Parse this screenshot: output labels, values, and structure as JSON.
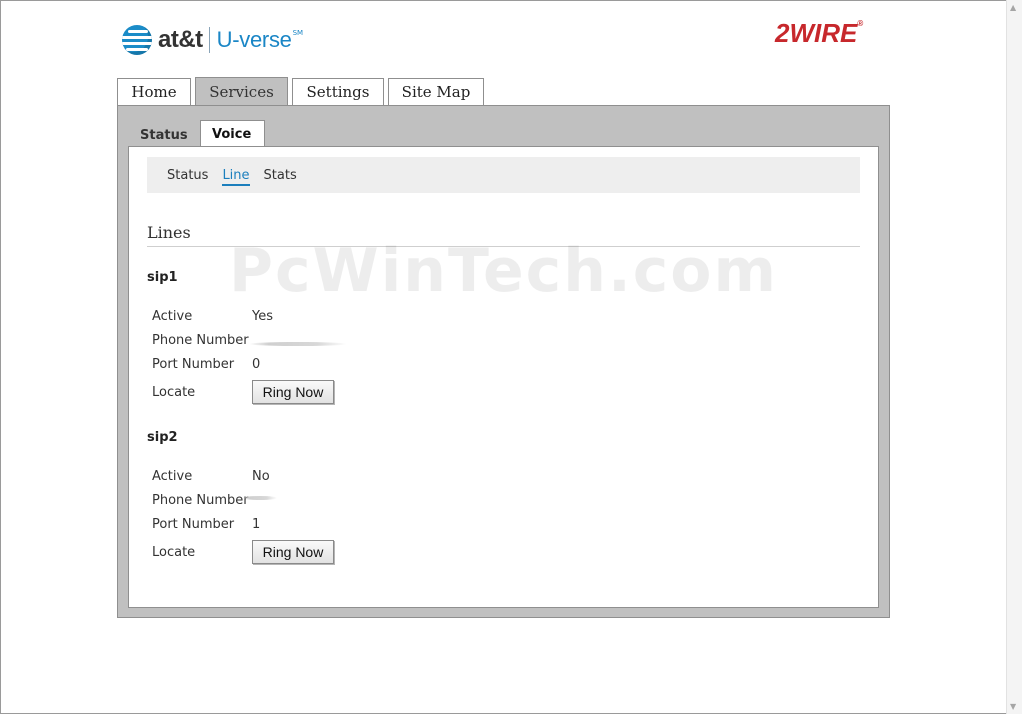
{
  "brand": {
    "att_text": "at&t",
    "uverse_text": "U-verse",
    "uverse_tm": "SM",
    "twowire_text": "2WIRE",
    "twowire_reg": "®",
    "att_color": "#1b8cc8",
    "twowire_color": "#c7282c"
  },
  "main_tabs": [
    {
      "label": "Home",
      "active": false
    },
    {
      "label": "Services",
      "active": true
    },
    {
      "label": "Settings",
      "active": false
    },
    {
      "label": "Site Map",
      "active": false
    }
  ],
  "sub_tabs": [
    {
      "label": "Status",
      "active": false
    },
    {
      "label": "Voice",
      "active": true
    }
  ],
  "subnav": [
    {
      "label": "Status",
      "active": false
    },
    {
      "label": "Line",
      "active": true
    },
    {
      "label": "Stats",
      "active": false
    }
  ],
  "section_title": "Lines",
  "lines": [
    {
      "name": "sip1",
      "active_label": "Active",
      "active_value": "Yes",
      "phone_label": "Phone Number",
      "port_label": "Port Number",
      "port_value": "0",
      "locate_label": "Locate",
      "button_label": "Ring Now"
    },
    {
      "name": "sip2",
      "active_label": "Active",
      "active_value": "No",
      "phone_label": "Phone Number",
      "port_label": "Port Number",
      "port_value": "1",
      "locate_label": "Locate",
      "button_label": "Ring Now"
    }
  ],
  "watermark": "PcWinTech.com",
  "accent_color": "#1c7fbd"
}
